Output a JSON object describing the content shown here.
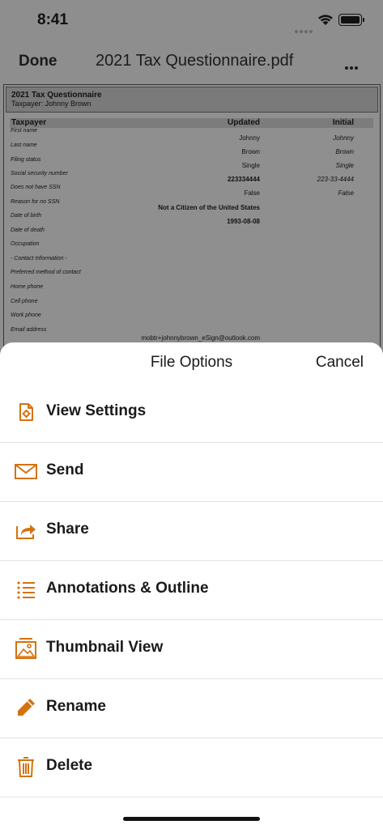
{
  "status": {
    "time": "8:41"
  },
  "nav": {
    "done_label": "Done",
    "title": "2021 Tax Questionnaire.pdf"
  },
  "document": {
    "title": "2021 Tax Questionnaire",
    "subtitle": "Taxpayer: Johnny Brown",
    "columns": [
      "Taxpayer",
      "Updated",
      "Initial"
    ],
    "rows": [
      {
        "label": "First name",
        "updated": "Johnny",
        "initial": "Johnny"
      },
      {
        "label": "Last name",
        "updated": "Brown",
        "initial": "Brown"
      },
      {
        "label": "Filing status",
        "updated": "Single",
        "initial": "Single"
      },
      {
        "label": "Social security number",
        "updated": "223334444",
        "initial": "223-33-4444"
      },
      {
        "label": "Does not have SSN",
        "updated": "False",
        "initial": "False"
      },
      {
        "label": "Reason for no SSN",
        "updated": "Not a Citizen of the United States",
        "initial": ""
      },
      {
        "label": "Date of birth",
        "updated": "1993-08-08",
        "initial": ""
      },
      {
        "label": "Date of death",
        "updated": "",
        "initial": ""
      },
      {
        "label": "Occupation",
        "updated": "",
        "initial": ""
      },
      {
        "label": "- Contact Information -",
        "updated": "",
        "initial": ""
      },
      {
        "label": "Preferred method of contact",
        "updated": "",
        "initial": ""
      },
      {
        "label": "Home phone",
        "updated": "",
        "initial": ""
      },
      {
        "label": "Cell phone",
        "updated": "",
        "initial": ""
      },
      {
        "label": "Work phone",
        "updated": "",
        "initial": ""
      },
      {
        "label": "Email address",
        "updated": "mobtr+johnnybrown_eSign@outlook.com",
        "initial": ""
      }
    ]
  },
  "sheet": {
    "title": "File Options",
    "cancel_label": "Cancel",
    "options": [
      {
        "label": "View Settings",
        "icon": "document-gear-icon"
      },
      {
        "label": "Send",
        "icon": "envelope-icon"
      },
      {
        "label": "Share",
        "icon": "share-arrow-icon"
      },
      {
        "label": "Annotations & Outline",
        "icon": "list-icon"
      },
      {
        "label": "Thumbnail View",
        "icon": "image-icon"
      },
      {
        "label": "Rename",
        "icon": "pencil-icon"
      },
      {
        "label": "Delete",
        "icon": "trash-icon"
      }
    ]
  },
  "colors": {
    "accent": "#d4720f",
    "dim_overlay": "#8e8e8e"
  }
}
